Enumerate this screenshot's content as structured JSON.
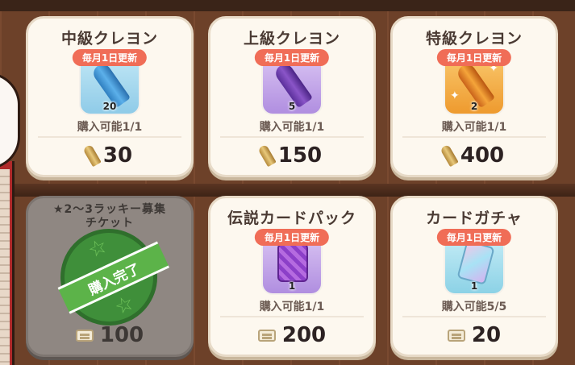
{
  "items": [
    {
      "title": "中級クレヨン",
      "badge": "毎月1日更新",
      "quantity": "20",
      "limit": "購入可能1/1",
      "price": "30",
      "currency_icon": "bullet-icon",
      "icon": "blue-crayon-icon",
      "color": "#4a9fd8"
    },
    {
      "title": "上級クレヨン",
      "badge": "毎月1日更新",
      "quantity": "5",
      "limit": "購入可能1/1",
      "price": "150",
      "currency_icon": "bullet-icon",
      "icon": "purple-crayon-icon",
      "color": "#8a55c8"
    },
    {
      "title": "特級クレヨン",
      "badge": "毎月1日更新",
      "quantity": "2",
      "limit": "購入可能1/1",
      "price": "400",
      "currency_icon": "bullet-icon",
      "icon": "orange-crayon-icon",
      "color": "#f09a2a"
    },
    {
      "title": "★2～3ラッキー募集チケット",
      "stamp": "購入完了",
      "price": "100",
      "currency_icon": "ticket-icon",
      "sold_out": true
    },
    {
      "title": "伝説カードパック",
      "badge": "毎月1日更新",
      "quantity": "1",
      "limit": "購入可能1/1",
      "price": "200",
      "currency_icon": "ticket-icon",
      "icon": "card-pack-icon",
      "color": "#9b59d0"
    },
    {
      "title": "カードガチャ",
      "badge": "毎月1日更新",
      "quantity": "1",
      "limit": "購入可能5/5",
      "price": "20",
      "currency_icon": "ticket-icon",
      "icon": "card-gacha-icon",
      "color": "#7ad0e8"
    }
  ]
}
